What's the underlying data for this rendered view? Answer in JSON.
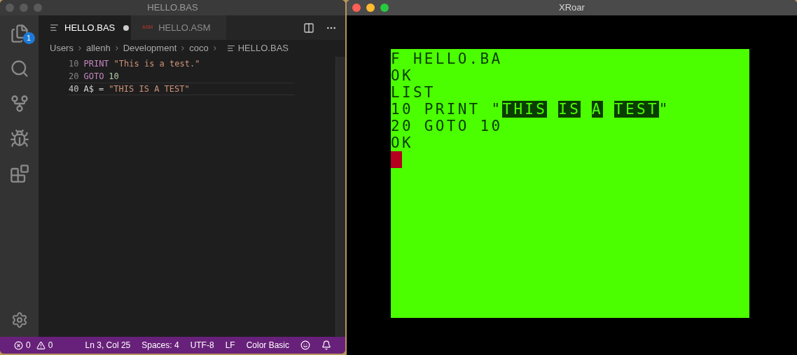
{
  "editor_window": {
    "title": "HELLO.BAS",
    "activity_bar": {
      "explorer_badge": "1"
    },
    "tabs": [
      {
        "label": "HELLO.BAS",
        "selected": true,
        "dirty": true,
        "icon": {
          "kind": "lines"
        }
      },
      {
        "label": "HELLO.ASM",
        "selected": false,
        "dirty": false,
        "icon": {
          "kind": "text",
          "text": "ASM"
        }
      }
    ],
    "breadcrumbs": [
      "Users",
      "allenh",
      "Development",
      "coco",
      "HELLO.BAS"
    ],
    "code_lines": [
      {
        "number": "10",
        "tokens": [
          {
            "kind": "keyword",
            "text": "PRINT"
          },
          {
            "kind": "string",
            "text": "\"This is a test.\""
          }
        ],
        "current": false
      },
      {
        "number": "20",
        "tokens": [
          {
            "kind": "keyword",
            "text": "GOTO"
          },
          {
            "kind": "number",
            "text": "10"
          }
        ],
        "current": false
      },
      {
        "number": "40",
        "tokens": [
          {
            "kind": "plain",
            "text": "A$"
          },
          {
            "kind": "plain",
            "text": "="
          },
          {
            "kind": "string",
            "text": "\"THIS IS A TEST\""
          }
        ],
        "current": true
      }
    ],
    "status_bar": {
      "errors": "0",
      "warnings": "0",
      "items": [
        "Ln 3, Col 25",
        "Spaces: 4",
        "UTF-8",
        "LF",
        "Color Basic"
      ]
    }
  },
  "emulator_window": {
    "title": "XRoar",
    "screen_lines": [
      [
        {
          "text": "F HELLO.BA",
          "inverse": false
        }
      ],
      [
        {
          "text": "OK",
          "inverse": false
        }
      ],
      [
        {
          "text": "LIST",
          "inverse": false
        }
      ],
      [
        {
          "text": "10 PRINT \"",
          "inverse": false
        },
        {
          "text": "THIS",
          "inverse": true,
          "space_after": true
        },
        {
          "text": "IS",
          "inverse": true,
          "space_after": true
        },
        {
          "text": "A",
          "inverse": true,
          "space_after": true
        },
        {
          "text": "TEST",
          "inverse": true
        },
        {
          "text": "\"",
          "inverse": false
        }
      ],
      [
        {
          "text": "20 GOTO 10",
          "inverse": false
        }
      ],
      [
        {
          "text": "OK",
          "inverse": false
        }
      ]
    ]
  }
}
